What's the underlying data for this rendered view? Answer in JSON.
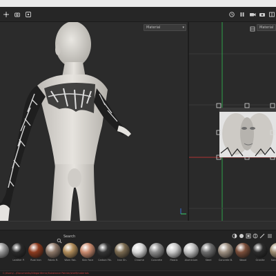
{
  "viewport3d": {
    "material_dropdown": "Material"
  },
  "viewport2d": {
    "material_dropdown": "Material"
  },
  "shelf": {
    "search_label": "Search",
    "materials": [
      {
        "label": "",
        "color": "#9a9a9a"
      },
      {
        "label": "Leather P.",
        "color": "#2a2a2a"
      },
      {
        "label": "Rust Iron",
        "color": "#8b3a1e"
      },
      {
        "label": "Fabric R.",
        "color": "#8c7768"
      },
      {
        "label": "Worn Fab.",
        "color": "#b08c5a"
      },
      {
        "label": "Skin Face",
        "color": "#c98a6e"
      },
      {
        "label": "Carbon Fib.",
        "color": "#333333"
      },
      {
        "label": "Iron Sh.",
        "color": "#7a6a50"
      },
      {
        "label": "Chrome",
        "color": "#d8d8d8"
      },
      {
        "label": "Concrete",
        "color": "#8a8a8a"
      },
      {
        "label": "Plastic",
        "color": "#c8c8c8"
      },
      {
        "label": "Aluminium",
        "color": "#c0c0c0"
      },
      {
        "label": "Steel",
        "color": "#6c6c6c"
      },
      {
        "label": "Concrete B.",
        "color": "#9c8e80"
      },
      {
        "label": "Wood",
        "color": "#7a4e3a"
      },
      {
        "label": "Granite",
        "color": "#2b2b2b"
      },
      {
        "label": "Sandstone",
        "color": "#9c8a70"
      }
    ]
  },
  "status": {
    "text": "C:/Users/.../Documents/Allegorithmic/Substance Painter/shelf/materials"
  }
}
